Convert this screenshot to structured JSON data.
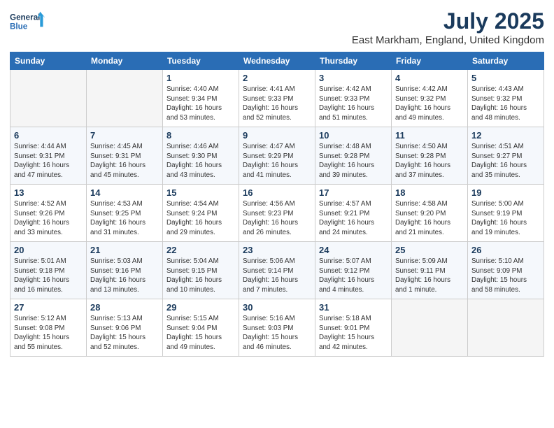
{
  "header": {
    "logo_line1": "General",
    "logo_line2": "Blue",
    "title": "July 2025",
    "subtitle": "East Markham, England, United Kingdom"
  },
  "days_of_week": [
    "Sunday",
    "Monday",
    "Tuesday",
    "Wednesday",
    "Thursday",
    "Friday",
    "Saturday"
  ],
  "weeks": [
    [
      {
        "day": "",
        "info": ""
      },
      {
        "day": "",
        "info": ""
      },
      {
        "day": "1",
        "info": "Sunrise: 4:40 AM\nSunset: 9:34 PM\nDaylight: 16 hours and 53 minutes."
      },
      {
        "day": "2",
        "info": "Sunrise: 4:41 AM\nSunset: 9:33 PM\nDaylight: 16 hours and 52 minutes."
      },
      {
        "day": "3",
        "info": "Sunrise: 4:42 AM\nSunset: 9:33 PM\nDaylight: 16 hours and 51 minutes."
      },
      {
        "day": "4",
        "info": "Sunrise: 4:42 AM\nSunset: 9:32 PM\nDaylight: 16 hours and 49 minutes."
      },
      {
        "day": "5",
        "info": "Sunrise: 4:43 AM\nSunset: 9:32 PM\nDaylight: 16 hours and 48 minutes."
      }
    ],
    [
      {
        "day": "6",
        "info": "Sunrise: 4:44 AM\nSunset: 9:31 PM\nDaylight: 16 hours and 47 minutes."
      },
      {
        "day": "7",
        "info": "Sunrise: 4:45 AM\nSunset: 9:31 PM\nDaylight: 16 hours and 45 minutes."
      },
      {
        "day": "8",
        "info": "Sunrise: 4:46 AM\nSunset: 9:30 PM\nDaylight: 16 hours and 43 minutes."
      },
      {
        "day": "9",
        "info": "Sunrise: 4:47 AM\nSunset: 9:29 PM\nDaylight: 16 hours and 41 minutes."
      },
      {
        "day": "10",
        "info": "Sunrise: 4:48 AM\nSunset: 9:28 PM\nDaylight: 16 hours and 39 minutes."
      },
      {
        "day": "11",
        "info": "Sunrise: 4:50 AM\nSunset: 9:28 PM\nDaylight: 16 hours and 37 minutes."
      },
      {
        "day": "12",
        "info": "Sunrise: 4:51 AM\nSunset: 9:27 PM\nDaylight: 16 hours and 35 minutes."
      }
    ],
    [
      {
        "day": "13",
        "info": "Sunrise: 4:52 AM\nSunset: 9:26 PM\nDaylight: 16 hours and 33 minutes."
      },
      {
        "day": "14",
        "info": "Sunrise: 4:53 AM\nSunset: 9:25 PM\nDaylight: 16 hours and 31 minutes."
      },
      {
        "day": "15",
        "info": "Sunrise: 4:54 AM\nSunset: 9:24 PM\nDaylight: 16 hours and 29 minutes."
      },
      {
        "day": "16",
        "info": "Sunrise: 4:56 AM\nSunset: 9:23 PM\nDaylight: 16 hours and 26 minutes."
      },
      {
        "day": "17",
        "info": "Sunrise: 4:57 AM\nSunset: 9:21 PM\nDaylight: 16 hours and 24 minutes."
      },
      {
        "day": "18",
        "info": "Sunrise: 4:58 AM\nSunset: 9:20 PM\nDaylight: 16 hours and 21 minutes."
      },
      {
        "day": "19",
        "info": "Sunrise: 5:00 AM\nSunset: 9:19 PM\nDaylight: 16 hours and 19 minutes."
      }
    ],
    [
      {
        "day": "20",
        "info": "Sunrise: 5:01 AM\nSunset: 9:18 PM\nDaylight: 16 hours and 16 minutes."
      },
      {
        "day": "21",
        "info": "Sunrise: 5:03 AM\nSunset: 9:16 PM\nDaylight: 16 hours and 13 minutes."
      },
      {
        "day": "22",
        "info": "Sunrise: 5:04 AM\nSunset: 9:15 PM\nDaylight: 16 hours and 10 minutes."
      },
      {
        "day": "23",
        "info": "Sunrise: 5:06 AM\nSunset: 9:14 PM\nDaylight: 16 hours and 7 minutes."
      },
      {
        "day": "24",
        "info": "Sunrise: 5:07 AM\nSunset: 9:12 PM\nDaylight: 16 hours and 4 minutes."
      },
      {
        "day": "25",
        "info": "Sunrise: 5:09 AM\nSunset: 9:11 PM\nDaylight: 16 hours and 1 minute."
      },
      {
        "day": "26",
        "info": "Sunrise: 5:10 AM\nSunset: 9:09 PM\nDaylight: 15 hours and 58 minutes."
      }
    ],
    [
      {
        "day": "27",
        "info": "Sunrise: 5:12 AM\nSunset: 9:08 PM\nDaylight: 15 hours and 55 minutes."
      },
      {
        "day": "28",
        "info": "Sunrise: 5:13 AM\nSunset: 9:06 PM\nDaylight: 15 hours and 52 minutes."
      },
      {
        "day": "29",
        "info": "Sunrise: 5:15 AM\nSunset: 9:04 PM\nDaylight: 15 hours and 49 minutes."
      },
      {
        "day": "30",
        "info": "Sunrise: 5:16 AM\nSunset: 9:03 PM\nDaylight: 15 hours and 46 minutes."
      },
      {
        "day": "31",
        "info": "Sunrise: 5:18 AM\nSunset: 9:01 PM\nDaylight: 15 hours and 42 minutes."
      },
      {
        "day": "",
        "info": ""
      },
      {
        "day": "",
        "info": ""
      }
    ]
  ]
}
